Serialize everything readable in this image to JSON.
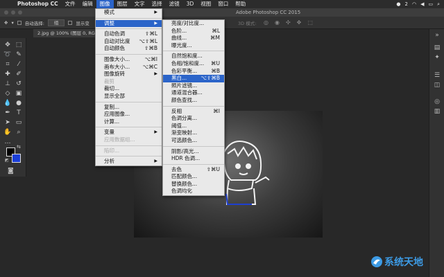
{
  "menubar": {
    "apple": "",
    "app": "Photoshop CC",
    "items": [
      "文件",
      "编辑",
      "图像",
      "图层",
      "文字",
      "选择",
      "滤镜",
      "3D",
      "视图",
      "窗口",
      "帮助"
    ],
    "active_index": 2,
    "notifications": "2"
  },
  "title": "Adobe Photoshop CC 2015",
  "options_bar": {
    "auto_select": "自动选择:",
    "layer_select": "组",
    "show_transform": "显示变",
    "mode_3d": "3D 模式:"
  },
  "doc_tab": "2.jpg @ 100% (图层 0, RGB/",
  "image_menu": [
    {
      "label": "模式",
      "submenu": true
    },
    {
      "sep": true
    },
    {
      "label": "调整",
      "submenu": true,
      "hl": true
    },
    {
      "sep": true
    },
    {
      "label": "自动色调",
      "sc": "⇧⌘L"
    },
    {
      "label": "自动对比度",
      "sc": "⌥⇧⌘L"
    },
    {
      "label": "自动颜色",
      "sc": "⇧⌘B"
    },
    {
      "sep": true
    },
    {
      "label": "图像大小...",
      "sc": "⌥⌘I"
    },
    {
      "label": "画布大小...",
      "sc": "⌥⌘C"
    },
    {
      "label": "图像旋转",
      "submenu": true
    },
    {
      "label": "裁剪",
      "disabled": true
    },
    {
      "label": "裁切..."
    },
    {
      "label": "显示全部"
    },
    {
      "sep": true
    },
    {
      "label": "复制..."
    },
    {
      "label": "应用图像..."
    },
    {
      "label": "计算..."
    },
    {
      "sep": true
    },
    {
      "label": "变量",
      "submenu": true
    },
    {
      "label": "应用数据组...",
      "disabled": true
    },
    {
      "sep": true
    },
    {
      "label": "陷印...",
      "disabled": true
    },
    {
      "sep": true
    },
    {
      "label": "分析",
      "submenu": true
    }
  ],
  "adjust_menu": [
    {
      "label": "亮度/对比度..."
    },
    {
      "label": "色阶...",
      "sc": "⌘L"
    },
    {
      "label": "曲线...",
      "sc": "⌘M"
    },
    {
      "label": "曝光度..."
    },
    {
      "sep": true
    },
    {
      "label": "自然饱和度..."
    },
    {
      "label": "色相/饱和度...",
      "sc": "⌘U"
    },
    {
      "label": "色彩平衡...",
      "sc": "⌘B"
    },
    {
      "label": "黑白...",
      "sc": "⌥⇧⌘B",
      "hl": true
    },
    {
      "label": "照片滤镜..."
    },
    {
      "label": "通道混合器..."
    },
    {
      "label": "颜色查找..."
    },
    {
      "sep": true
    },
    {
      "label": "反相",
      "sc": "⌘I"
    },
    {
      "label": "色调分离..."
    },
    {
      "label": "阈值..."
    },
    {
      "label": "渐变映射..."
    },
    {
      "label": "可选颜色..."
    },
    {
      "sep": true
    },
    {
      "label": "阴影/高光..."
    },
    {
      "label": "HDR 色调..."
    },
    {
      "sep": true
    },
    {
      "label": "去色",
      "sc": "⇧⌘U"
    },
    {
      "label": "匹配颜色..."
    },
    {
      "label": "替换颜色..."
    },
    {
      "label": "色调均化"
    }
  ],
  "watermark": "系统天地",
  "colors": {
    "accent": "#2b64c9",
    "bg_color": "#1b3fd8",
    "fg_color": "#000000"
  }
}
